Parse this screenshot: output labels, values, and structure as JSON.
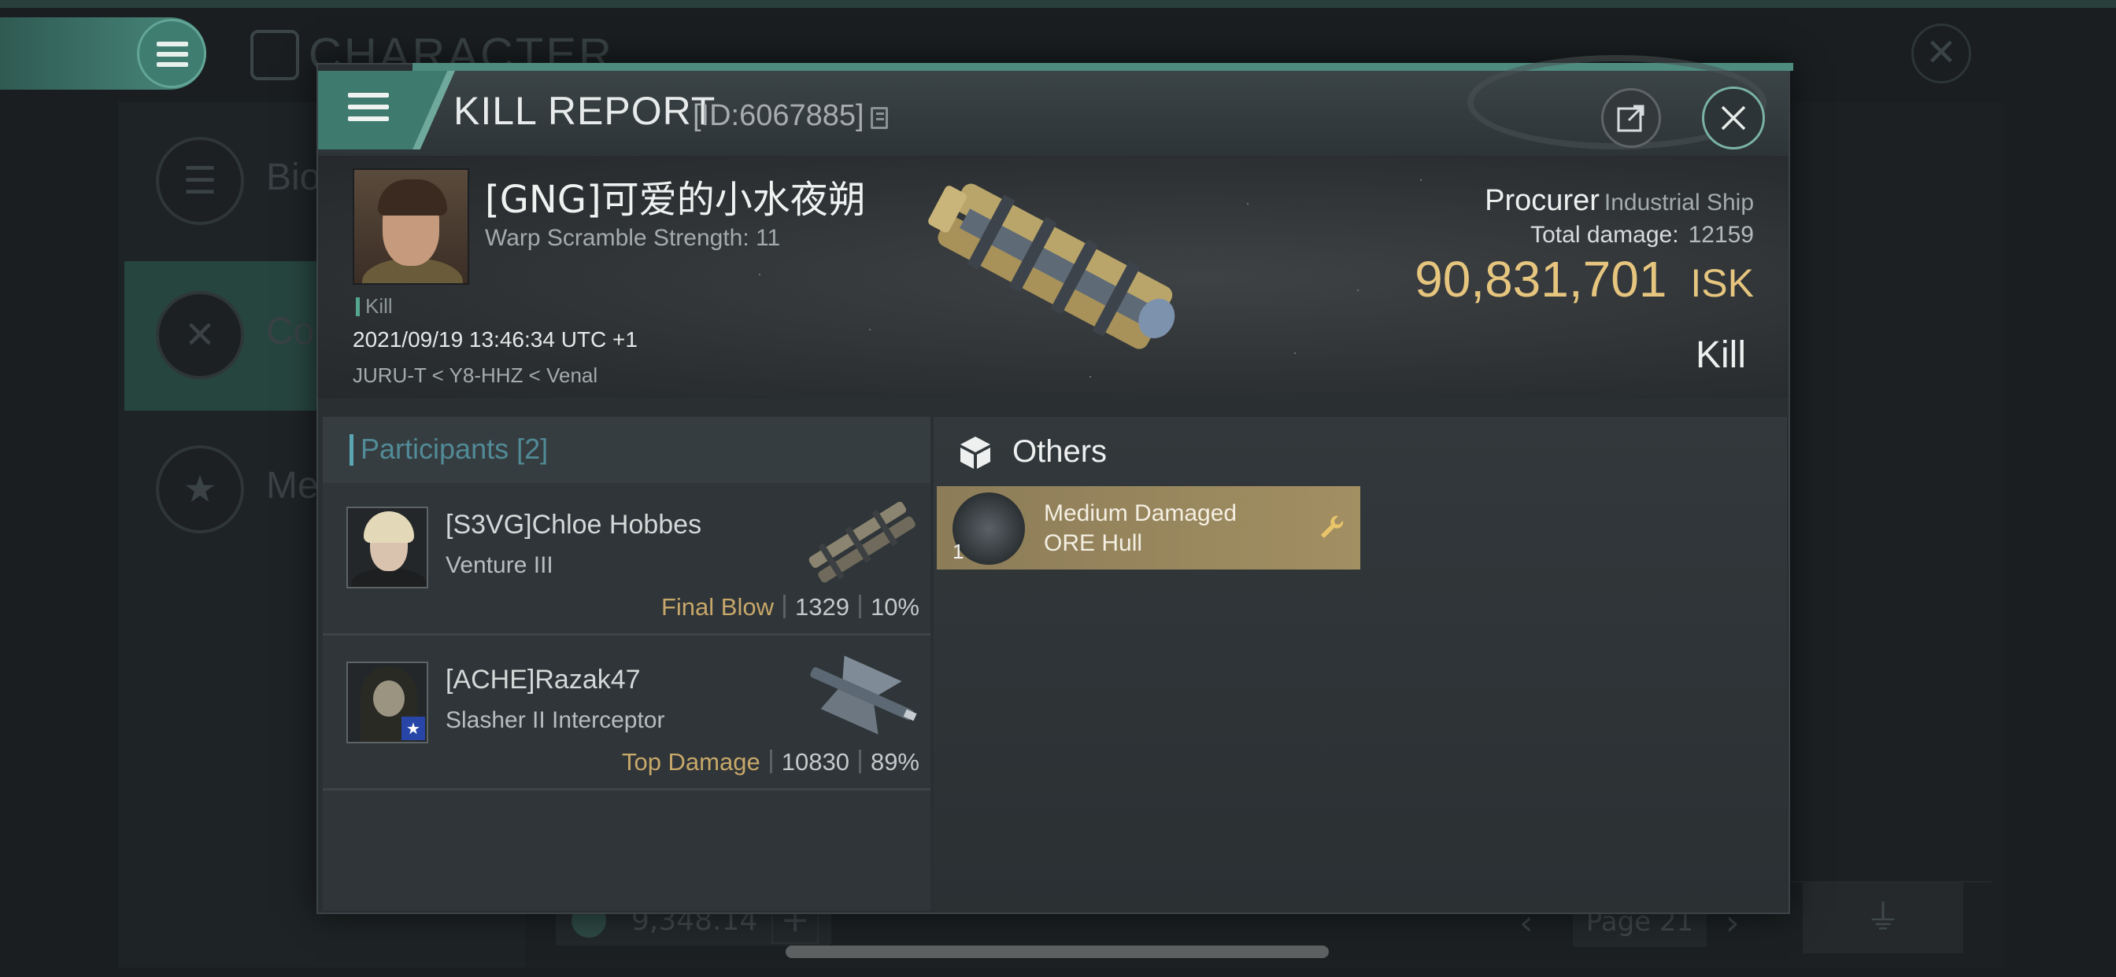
{
  "background": {
    "title": "CHARACTER",
    "nav_items": [
      {
        "label": "Bio",
        "icon": "list-icon"
      },
      {
        "label": "Co",
        "icon": "crossed-swords-icon"
      },
      {
        "label": "Me",
        "icon": "star-medal-icon"
      }
    ],
    "wallet_value": "9,348.14",
    "page_label": "Page 21"
  },
  "modal": {
    "title": "KILL REPORT",
    "report_id": "[ID:6067885]",
    "victim": {
      "name": "[GNG]可爱的小水夜朔",
      "warp_scramble": "Warp Scramble Strength: 11",
      "kill_tag": "Kill",
      "timestamp": "2021/09/19 13:46:34 UTC +1",
      "location": "JURU-T < Y8-HHZ < Venal"
    },
    "ship": {
      "name": "Procurer",
      "class": "Industrial Ship",
      "total_damage_label": "Total damage:",
      "total_damage": "12159",
      "isk_value": "90,831,701",
      "isk_unit": "ISK",
      "result": "Kill"
    },
    "participants": {
      "header": "Participants [2]",
      "items": [
        {
          "name": "[S3VG]Chloe Hobbes",
          "ship": "Venture III",
          "tag": "Final Blow",
          "damage": "1329",
          "percent": "10%"
        },
        {
          "name": "[ACHE]Razak47",
          "ship": "Slasher II Interceptor",
          "tag": "Top Damage",
          "damage": "10830",
          "percent": "89%"
        }
      ]
    },
    "others": {
      "title": "Others",
      "items": [
        {
          "name_line1": "Medium Damaged",
          "name_line2": "ORE Hull",
          "quantity": "1",
          "icon": "wrench-icon"
        }
      ]
    }
  },
  "colors": {
    "accent_teal": "#4e8c80",
    "isk_gold": "#e6c57f",
    "tag_gold": "#c8a86a",
    "participants_blue": "#5aa6b4",
    "item_card": "#a28f62"
  }
}
